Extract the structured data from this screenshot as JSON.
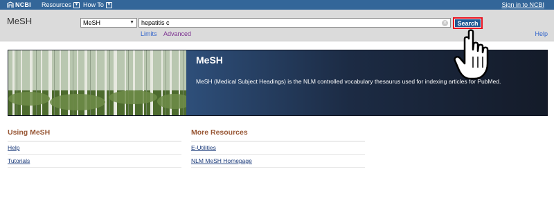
{
  "topbar": {
    "logo_text": "NCBI",
    "menu": [
      {
        "label": "Resources"
      },
      {
        "label": "How To"
      }
    ],
    "signin_label": "Sign in to NCBI"
  },
  "search": {
    "app_title": "MeSH",
    "db_selected": "MeSH",
    "query": "hepatitis c",
    "button_label": "Search",
    "limits_label": "Limits",
    "advanced_label": "Advanced",
    "help_label": "Help"
  },
  "hero": {
    "heading": "MeSH",
    "description": "MeSH (Medical Subject Headings) is the NLM controlled vocabulary thesaurus used for indexing articles for PubMed."
  },
  "sections": [
    {
      "title": "Using MeSH",
      "links": [
        "Help",
        "Tutorials"
      ]
    },
    {
      "title": "More Resources",
      "links": [
        "E-Utilities",
        "NLM MeSH Homepage"
      ]
    }
  ],
  "colors": {
    "topbar": "#336699",
    "search_button": "#1f5a94",
    "highlight": "#e8101e",
    "section_heading": "#985735"
  },
  "icons": {
    "logo": "ncbi-logo-icon",
    "dropdown": "chevron-down-icon",
    "clear": "clear-icon",
    "cursor": "hand-pointer-icon"
  }
}
